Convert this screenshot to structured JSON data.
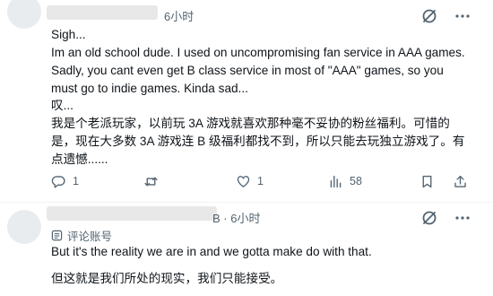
{
  "post": {
    "time": "6小时",
    "text_en": "Sigh...\nIm an old school dude. I used on uncompromising fan service in AAA games. Sadly, you cant even get B class service in most of \"AAA\" games, so you must go to indie games. Kinda sad...",
    "text_zh": "叹...\n我是个老派玩家，以前玩 3A 游戏就喜欢那种毫不妥协的粉丝福利。可惜的是，现在大多数 3A 游戏连 B 级福利都找不到，所以只能去玩独立游戏了。有点遗憾......",
    "actions": {
      "replies": "1",
      "reposts": "",
      "likes": "1",
      "views": "58"
    }
  },
  "reply": {
    "time_fragment": "B · 6小时",
    "badge_label": "评论账号",
    "text_en": "But it's the reality we are in and we gotta make do with that.",
    "text_zh": "但这就是我们所处的现实，我们只能接受。"
  },
  "icons": {
    "grok": "grok-icon",
    "more": "more-icon",
    "reply": "reply-icon",
    "repost": "repost-icon",
    "like": "like-icon",
    "views": "views-icon",
    "bookmark": "bookmark-icon",
    "share": "share-icon",
    "badge": "account-badge-icon"
  },
  "colors": {
    "text": "#0f1419",
    "secondary": "#536471",
    "divider": "#eff3f4"
  }
}
